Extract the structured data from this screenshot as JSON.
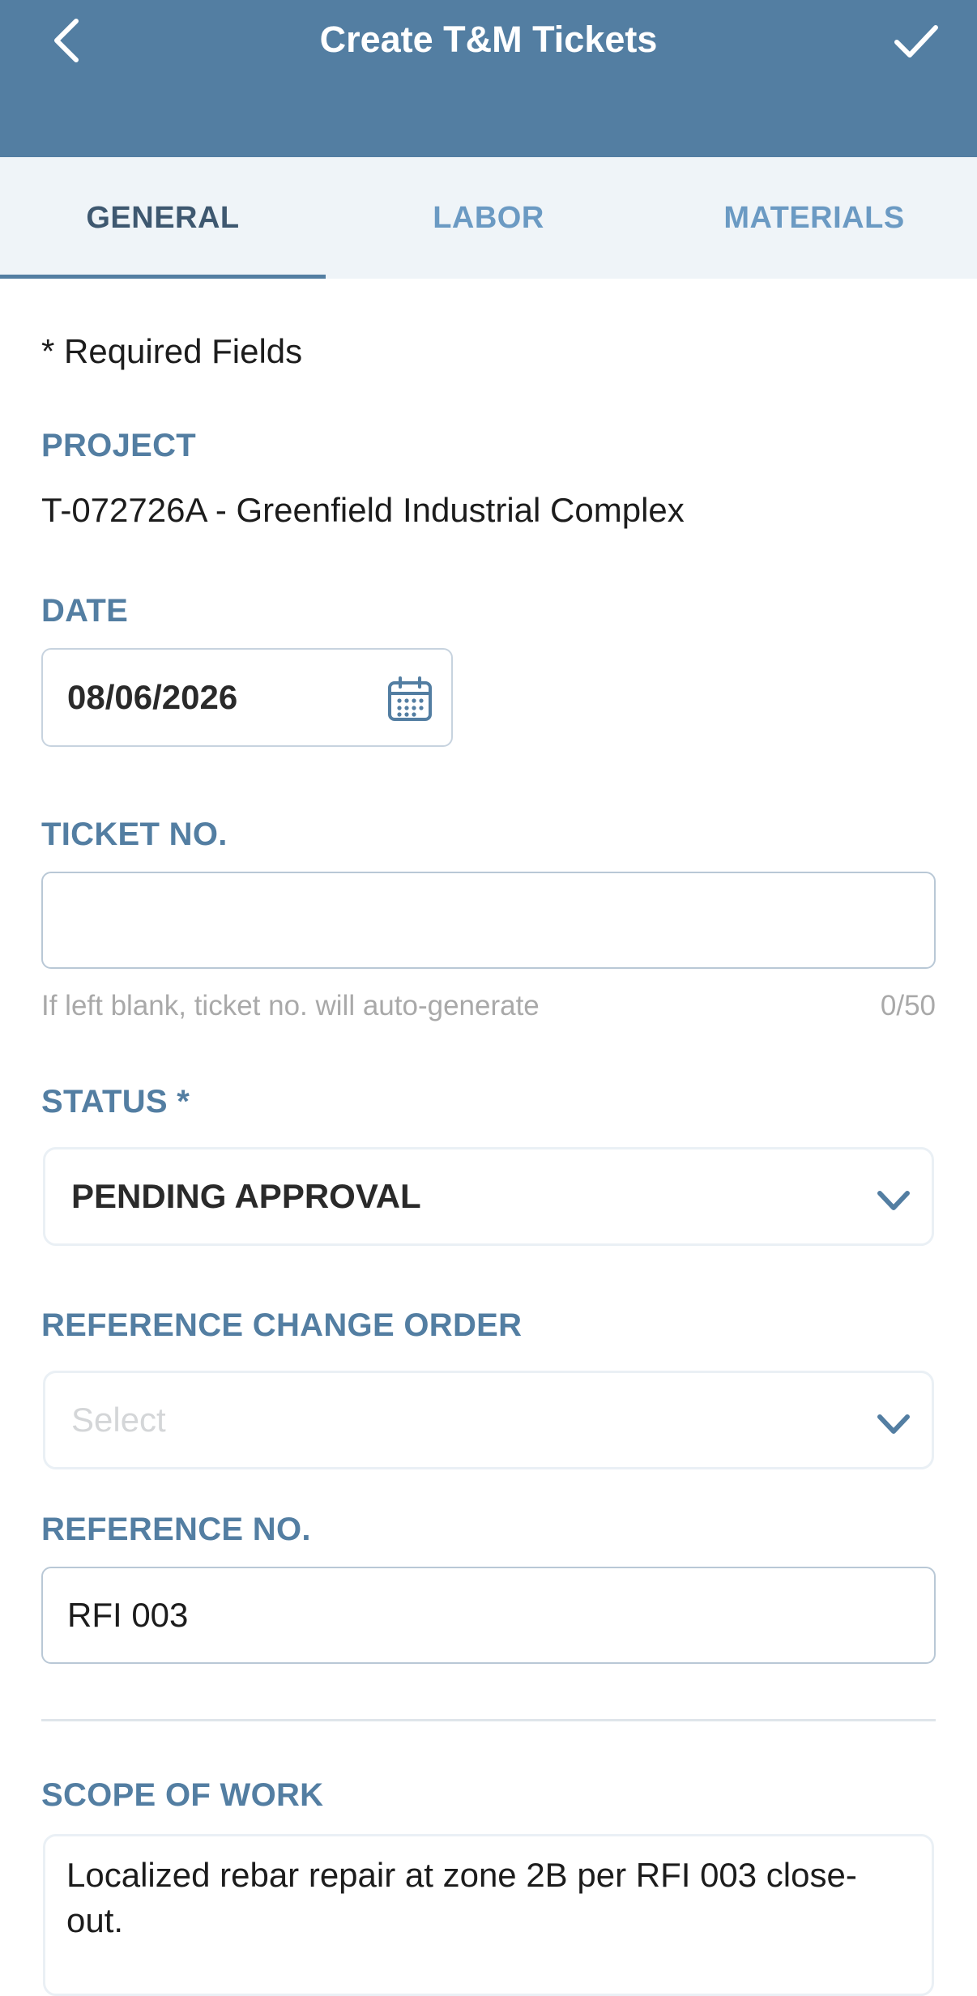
{
  "header": {
    "title": "Create T&M Tickets",
    "back_icon": "chevron-left-icon",
    "confirm_icon": "checkmark-icon",
    "background_color": "#537ea2"
  },
  "tabs": [
    {
      "label": "GENERAL",
      "active": true
    },
    {
      "label": "LABOR",
      "active": false
    },
    {
      "label": "MATERIALS",
      "active": false
    }
  ],
  "form": {
    "required_note": "* Required Fields",
    "project": {
      "label": "PROJECT",
      "value": "T-072726A - Greenfield Industrial Complex"
    },
    "date": {
      "label": "DATE",
      "value": "08/06/2026",
      "icon": "calendar-icon"
    },
    "ticket_no": {
      "label": "TICKET NO.",
      "value": "",
      "hint": "If left blank, ticket no. will auto-generate",
      "counter": "0/50"
    },
    "status": {
      "label": "STATUS *",
      "value": "PENDING APPROVAL",
      "icon": "chevron-down-icon"
    },
    "reference_change_order": {
      "label": "REFERENCE CHANGE ORDER",
      "placeholder": "Select",
      "icon": "chevron-down-icon"
    },
    "reference_no": {
      "label": "REFERENCE NO.",
      "value": "RFI 003"
    },
    "scope_of_work": {
      "label": "SCOPE OF WORK",
      "value": "Localized rebar repair at zone 2B per RFI 003 close-out."
    }
  },
  "colors": {
    "accent": "#537ea2",
    "tab_inactive": "#6b9ac3",
    "tab_active": "#3e5870",
    "tabs_background": "#eff4f8"
  }
}
